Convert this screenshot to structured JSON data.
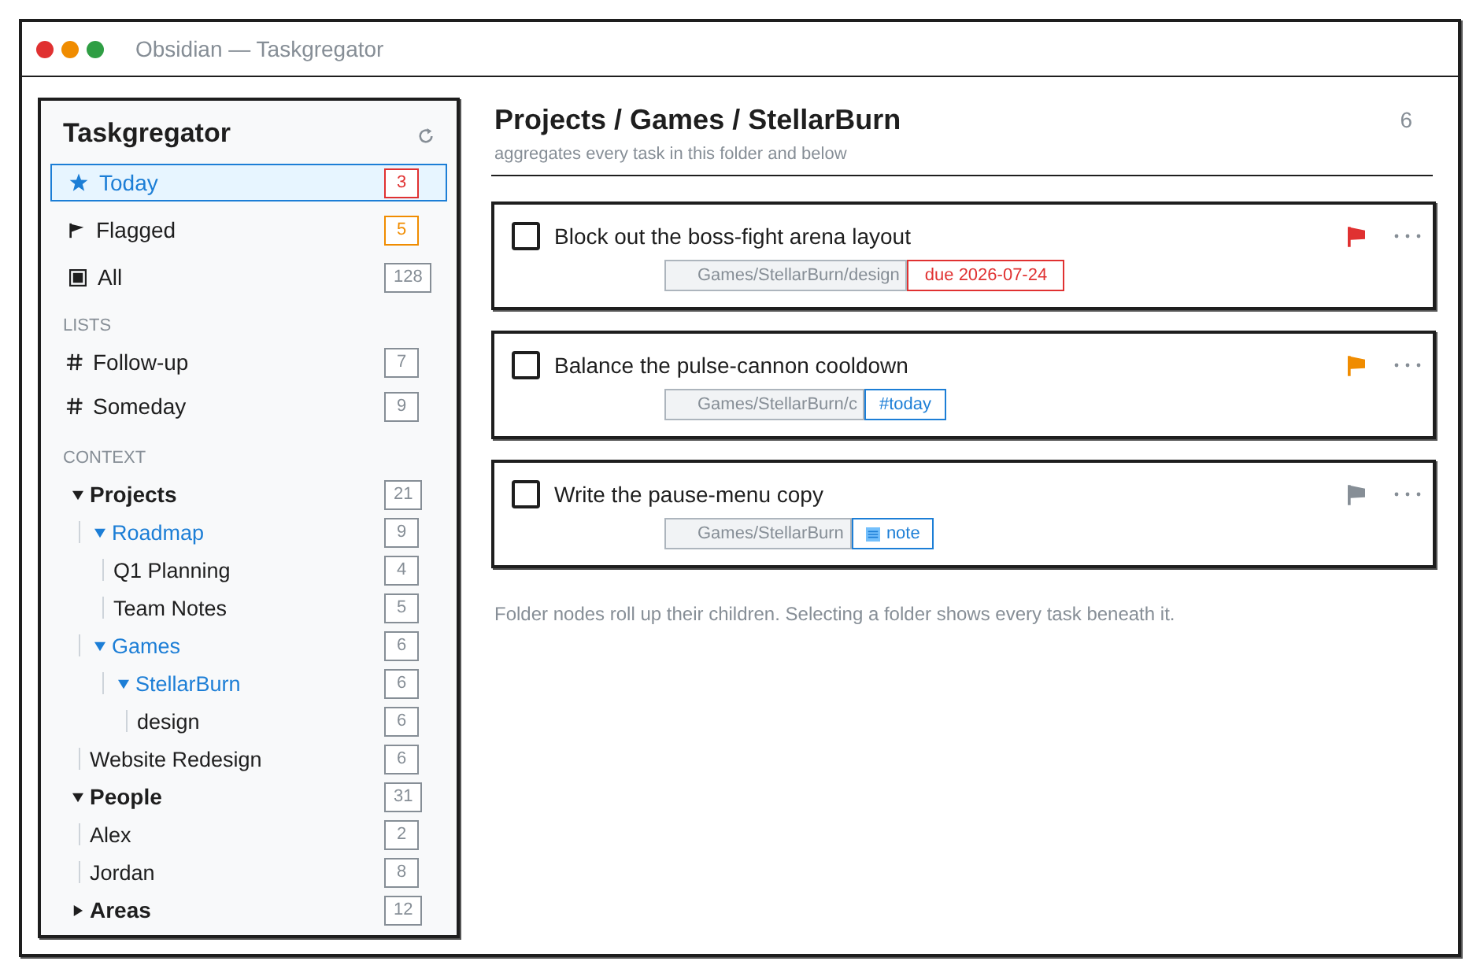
{
  "window": {
    "title": "Obsidian — Taskgregator"
  },
  "sidebar": {
    "title": "Taskgregator",
    "smart_lists": [
      {
        "kind": "today",
        "label": "Today",
        "count": "3",
        "color": "#e03131",
        "selected": true
      },
      {
        "kind": "flagged",
        "label": "Flagged",
        "count": "5",
        "color": "#f08c00",
        "selected": false
      },
      {
        "kind": "all",
        "label": "All",
        "count": "128",
        "color": "#868e96",
        "selected": false
      }
    ],
    "lists": {
      "heading": "LISTS",
      "items": [
        {
          "label": "Follow-up",
          "count": "7",
          "selected": false
        },
        {
          "label": "Someday",
          "count": "9",
          "selected": false
        }
      ]
    },
    "context": {
      "heading": "CONTEXT",
      "tree": [
        {
          "kind": "section",
          "label": "Projects",
          "count": "21",
          "expanded": true,
          "selected": false,
          "children": [
            {
              "kind": "folder",
              "label": "Roadmap",
              "count": "9",
              "expanded": true,
              "selected": false,
              "children": [
                {
                  "kind": "item",
                  "label": "Q1 Planning",
                  "count": "4",
                  "selected": false
                },
                {
                  "kind": "item",
                  "label": "Team Notes",
                  "count": "5",
                  "selected": false
                }
              ]
            },
            {
              "kind": "folder",
              "label": "Games",
              "count": "6",
              "expanded": true,
              "selected": false,
              "children": [
                {
                  "kind": "folder",
                  "label": "StellarBurn",
                  "count": "6",
                  "expanded": true,
                  "selected": false,
                  "children": [
                    {
                      "kind": "item",
                      "label": "design",
                      "count": "6",
                      "selected": false
                    }
                  ]
                }
              ]
            },
            {
              "kind": "item",
              "label": "Website Redesign",
              "count": "6",
              "selected": false
            }
          ]
        },
        {
          "kind": "section",
          "label": "People",
          "count": "31",
          "expanded": true,
          "selected": false,
          "children": [
            {
              "kind": "item",
              "label": "Alex",
              "count": "2",
              "selected": false
            },
            {
              "kind": "item",
              "label": "Jordan",
              "count": "8",
              "selected": false
            }
          ]
        },
        {
          "kind": "section",
          "label": "Areas",
          "count": "12",
          "expanded": false,
          "selected": false
        }
      ]
    }
  },
  "main": {
    "title": "Projects / Games / StellarBurn",
    "count": "6",
    "subtitle": "aggregates every task in this folder and below",
    "tasks": [
      {
        "title": "Block out the boss-fight arena layout",
        "checked": false,
        "color": "#e03131",
        "path": "Games/StellarBurn/design",
        "tag": {
          "kind": "due",
          "label": "due 2026-07-24"
        }
      },
      {
        "title": "Balance the pulse-cannon cooldown",
        "checked": false,
        "color": "#f08c00",
        "path": "Games/StellarBurn/c",
        "tag": {
          "kind": "tag",
          "label": "#today"
        }
      },
      {
        "title": "Write the pause-menu copy",
        "checked": false,
        "color": "#868e96",
        "path": "Games/StellarBurn",
        "tag": {
          "kind": "note",
          "label": "note"
        }
      }
    ],
    "note": "Folder nodes roll up their children. Selecting a folder shows every task beneath it."
  }
}
